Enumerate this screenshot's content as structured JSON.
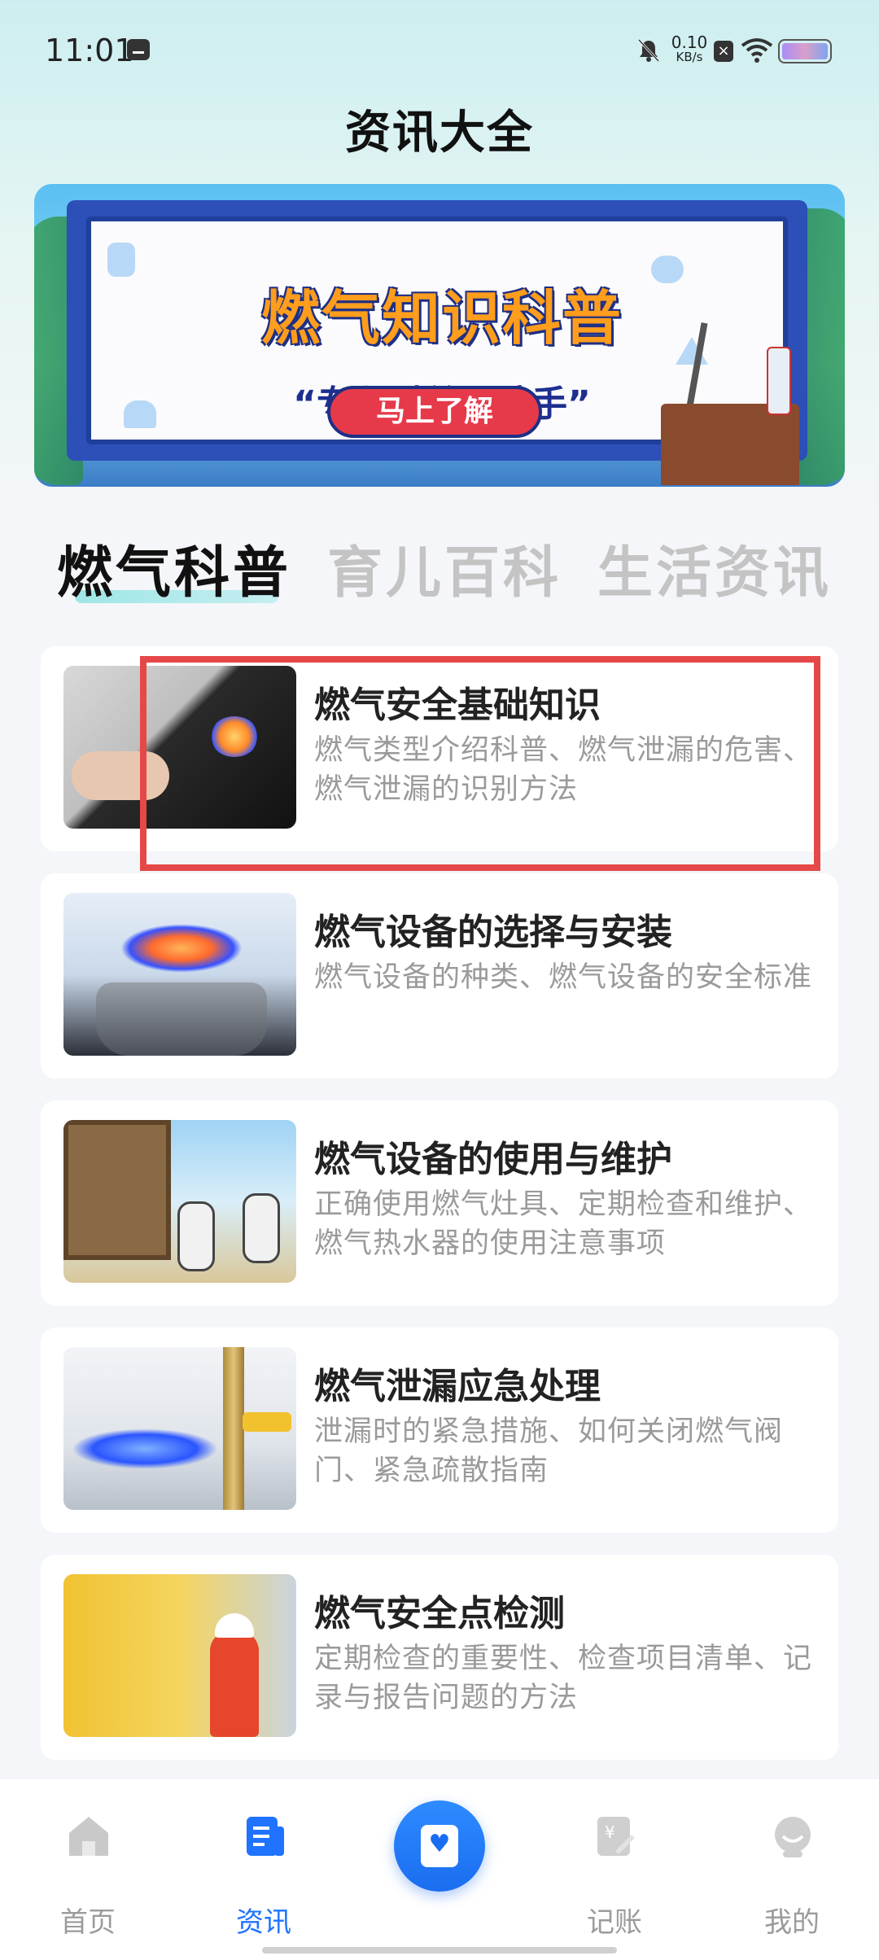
{
  "status_bar": {
    "time": "11:01",
    "net_speed_value": "0.10",
    "net_speed_unit": "KB/s",
    "icons": [
      "message-icon",
      "mute-icon",
      "sim-icon",
      "wifi-icon",
      "battery-icon"
    ]
  },
  "header": {
    "title": "资讯大全"
  },
  "banner": {
    "headline": "燃气知识科普",
    "subline": "“专业科普小助手”",
    "button": "马上了解"
  },
  "tabs": [
    {
      "label": "燃气科普",
      "active": true
    },
    {
      "label": "育儿百科",
      "active": false
    },
    {
      "label": "生活资讯",
      "active": false
    }
  ],
  "articles": [
    {
      "title": "燃气安全基础知识",
      "desc": "燃气类型介绍科普、燃气泄漏的危害、燃气泄漏的识别方法"
    },
    {
      "title": "燃气设备的选择与安装",
      "desc": " 燃气设备的种类、燃气设备的安全标准"
    },
    {
      "title": "燃气设备的使用与维护",
      "desc": "正确使用燃气灶具、定期检查和维护、燃气热水器的使用注意事项"
    },
    {
      "title": "燃气泄漏应急处理",
      "desc": "泄漏时的紧急措施、如何关闭燃气阀门、紧急疏散指南"
    },
    {
      "title": "燃气安全点检测",
      "desc": "定期检查的重要性、检查项目清单、记录与报告问题的方法"
    }
  ],
  "nav": {
    "items": [
      {
        "label": "首页",
        "icon": "home-icon",
        "active": false
      },
      {
        "label": "资讯",
        "icon": "news-icon",
        "active": true
      },
      {
        "label": "",
        "icon": "notebook-heart-icon",
        "active": false
      },
      {
        "label": "记账",
        "icon": "bookkeeping-icon",
        "active": false
      },
      {
        "label": "我的",
        "icon": "profile-icon",
        "active": false
      }
    ]
  },
  "colors": {
    "accent": "#1f73ff",
    "highlight": "#e54848",
    "tab_underline": "#9fe6e6"
  }
}
